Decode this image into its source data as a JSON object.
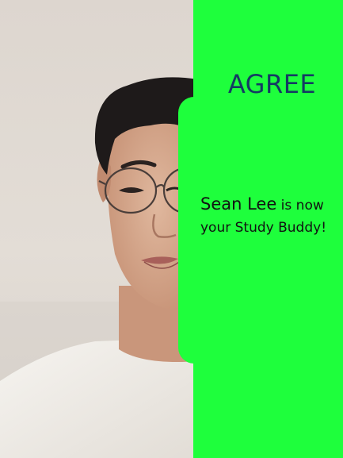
{
  "colors": {
    "panel_green": "#1eff3c",
    "title_navy": "#143a63",
    "text_dark": "#111111"
  },
  "match_card": {
    "title": "AGREE",
    "buddy_name": "Sean Lee",
    "message_middle": " is now",
    "message_end": "your Study Buddy!"
  },
  "photo": {
    "icon": "person-photo"
  }
}
